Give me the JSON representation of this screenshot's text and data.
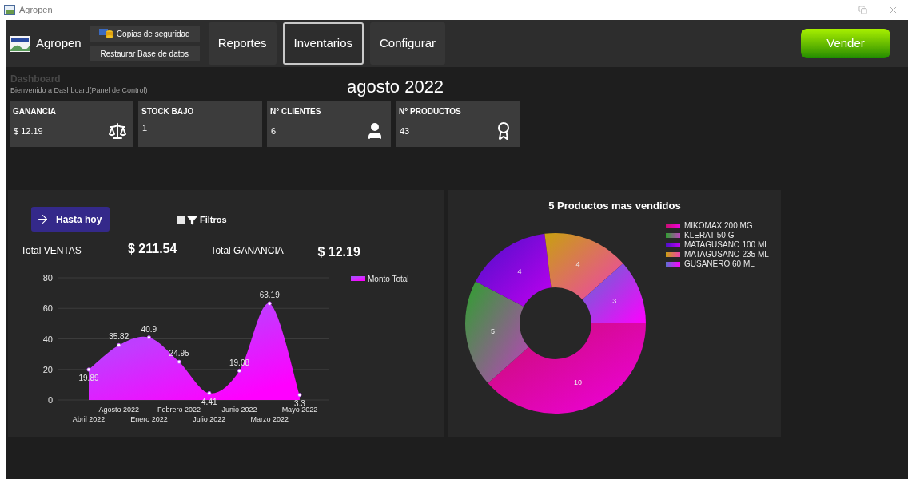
{
  "window": {
    "title": "Agropen"
  },
  "toolbar": {
    "app_name": "Agropen",
    "backup_buttons": [
      "Copias de seguridad",
      "Restaurar Base de datos"
    ],
    "tabs": [
      {
        "label": "Reportes",
        "selected": false
      },
      {
        "label": "Inventarios",
        "selected": true
      },
      {
        "label": "Configurar",
        "selected": false
      }
    ],
    "sell_button": "Vender"
  },
  "header": {
    "title": "Dashboard",
    "subtitle": "Bienvenido a Dashboard(Panel de Control)",
    "period": "agosto 2022"
  },
  "cards": [
    {
      "label": "GANANCIA",
      "value": "$ 12.19",
      "kind": "scale"
    },
    {
      "label": "STOCK BAJO",
      "value": "1",
      "kind": "none"
    },
    {
      "label": "N° CLIENTES",
      "value": "6",
      "kind": "user"
    },
    {
      "label": "N° PRODUCTOS",
      "value": "43",
      "kind": "award"
    }
  ],
  "sales_panel": {
    "range_button": "Hasta hoy",
    "filter": {
      "label": "Filtros",
      "checked": false
    },
    "totals": [
      {
        "label": "Total VENTAS",
        "value": "$ 211.54"
      },
      {
        "label": "Total GANANCIA",
        "value": "$ 12.19"
      }
    ],
    "chart_data": {
      "type": "area",
      "categories": [
        "Abril 2022",
        "Agosto 2022",
        "Enero 2022",
        "Febrero 2022",
        "Julio 2022",
        "Junio 2022",
        "Marzo 2022",
        "Mayo 2022"
      ],
      "series": [
        {
          "name": "Monto Total",
          "color": "#c13cff",
          "values": [
            19.89,
            35.82,
            40.9,
            24.95,
            4.41,
            19.08,
            63.19,
            3.3
          ]
        }
      ],
      "ylim": [
        0,
        80
      ],
      "yticks": [
        0,
        20,
        40,
        60,
        80
      ],
      "grid": true,
      "data_labels": true
    }
  },
  "products_panel": {
    "chart_data": {
      "type": "donut",
      "title": "5 Productos mas vendidos",
      "categories": [
        "MIKOMAX 200 MG",
        "KLERAT 50 G",
        "MATAGUSANO 100 ML",
        "MATAGUSANO 235 ML",
        "GUSANERO 60 ML"
      ],
      "values": [
        10,
        5,
        4,
        4,
        3
      ],
      "data_labels": true
    }
  }
}
